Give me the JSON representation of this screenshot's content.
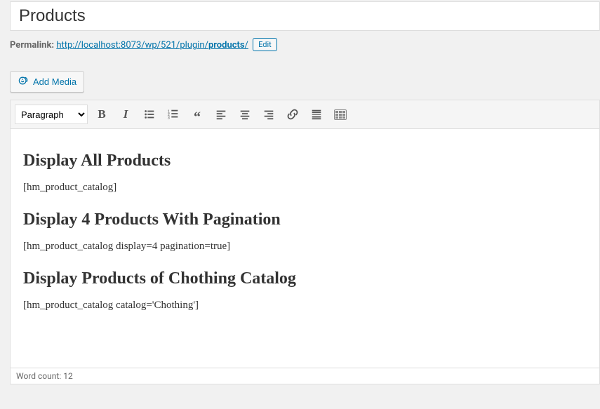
{
  "title_value": "Products",
  "permalink": {
    "label": "Permalink:",
    "base": "http://localhost:8073/wp/521/plugin/",
    "slug": "products",
    "trail": "/",
    "edit_label": "Edit"
  },
  "media_button_label": "Add Media",
  "toolbar": {
    "format_selected": "Paragraph"
  },
  "content": {
    "h1": "Display All Products",
    "p1": "[hm_product_catalog]",
    "h2": "Display 4 Products With Pagination",
    "p2": "[hm_product_catalog display=4 pagination=true]",
    "h3": "Display Products of Chothing Catalog",
    "p3": "[hm_product_catalog catalog='Chothing']"
  },
  "statusbar": {
    "word_count_label": "Word count:",
    "word_count_value": "12"
  }
}
